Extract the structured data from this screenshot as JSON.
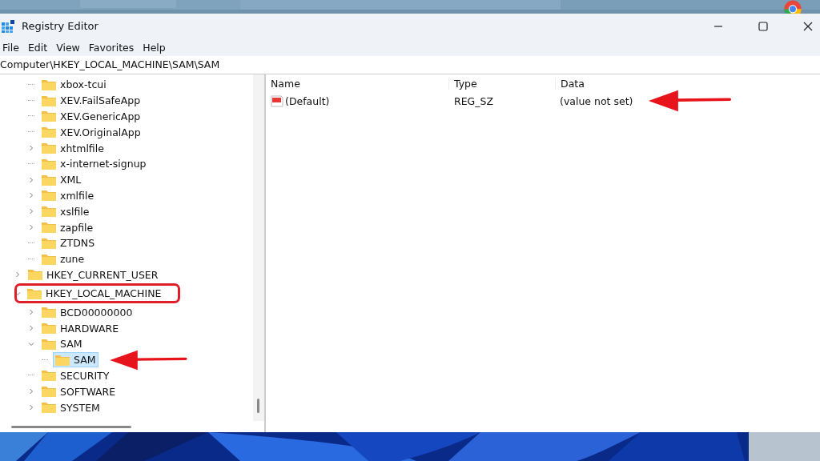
{
  "window": {
    "title": "Registry Editor"
  },
  "menu": [
    "File",
    "Edit",
    "View",
    "Favorites",
    "Help"
  ],
  "address": "Computer\\HKEY_LOCAL_MACHINE\\SAM\\SAM",
  "tree": {
    "continued_items": [
      {
        "label": "xbox-tcui",
        "selected": false
      },
      {
        "label": "XEV.FailSafeApp",
        "selected": false
      },
      {
        "label": "XEV.GenericApp",
        "selected": false
      },
      {
        "label": "XEV.OriginalApp",
        "selected": false
      },
      {
        "label": "xhtmlfile",
        "expanded": false,
        "selected": false
      },
      {
        "label": "x-internet-signup",
        "selected": false
      },
      {
        "label": "XML",
        "expanded": false,
        "selected": false
      },
      {
        "label": "xmlfile",
        "expanded": false,
        "selected": false
      },
      {
        "label": "xslfile",
        "expanded": false,
        "selected": false
      },
      {
        "label": "zapfile",
        "expanded": false,
        "selected": false
      },
      {
        "label": "ZTDNS",
        "selected": false
      },
      {
        "label": "zune",
        "selected": false
      }
    ],
    "items": [
      {
        "label": "HKEY_CURRENT_USER",
        "expanded": false,
        "selected": false
      },
      {
        "label": "HKEY_LOCAL_MACHINE",
        "expanded": true,
        "selected": false,
        "boxed": true,
        "children": [
          {
            "label": "BCD00000000",
            "expanded": false,
            "selected": false
          },
          {
            "label": "HARDWARE",
            "expanded": false,
            "selected": false
          },
          {
            "label": "SAM",
            "expanded": true,
            "selected": false,
            "children": [
              {
                "label": "SAM",
                "selected": true,
                "arrowed": true
              }
            ]
          },
          {
            "label": "SECURITY",
            "selected": false
          },
          {
            "label": "SOFTWARE",
            "expanded": false,
            "selected": false
          },
          {
            "label": "SYSTEM",
            "expanded": false,
            "selected": false
          }
        ]
      }
    ]
  },
  "values": {
    "columns": [
      "Name",
      "Type",
      "Data"
    ],
    "rows": [
      {
        "name": "(Default)",
        "type": "REG_SZ",
        "data": "(value not set)",
        "arrowed": true
      }
    ]
  }
}
